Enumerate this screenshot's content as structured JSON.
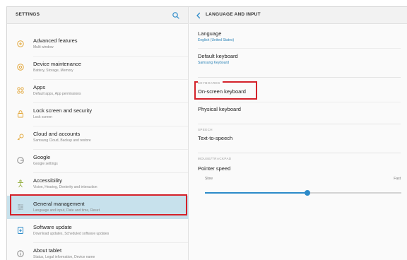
{
  "left_panel": {
    "title": "SETTINGS",
    "items": [
      {
        "title": "Advanced features",
        "subtitle": "Multi window",
        "icon": "puzzle-icon"
      },
      {
        "title": "Device maintenance",
        "subtitle": "Battery, Storage, Memory",
        "icon": "refresh-icon"
      },
      {
        "title": "Apps",
        "subtitle": "Default apps, App permissions",
        "icon": "apps-grid-icon"
      },
      {
        "title": "Lock screen and security",
        "subtitle": "Lock screen",
        "icon": "lock-icon"
      },
      {
        "title": "Cloud and accounts",
        "subtitle": "Samsung Cloud, Backup and restore",
        "icon": "key-icon"
      },
      {
        "title": "Google",
        "subtitle": "Google settings",
        "icon": "google-icon"
      },
      {
        "title": "Accessibility",
        "subtitle": "Vision, Hearing, Dexterity and interaction",
        "icon": "accessibility-icon"
      },
      {
        "title": "General management",
        "subtitle": "Language and input, Date and time, Reset",
        "icon": "sliders-icon"
      },
      {
        "title": "Software update",
        "subtitle": "Download updates, Scheduled software updates",
        "icon": "update-icon"
      },
      {
        "title": "About tablet",
        "subtitle": "Status, Legal information, Device name",
        "icon": "info-icon"
      }
    ],
    "selected_index": 7
  },
  "right_panel": {
    "title": "LANGUAGE AND INPUT",
    "language": {
      "title": "Language",
      "value": "English (United States)"
    },
    "default_keyboard": {
      "title": "Default keyboard",
      "value": "Samsung Keyboard"
    },
    "categories": {
      "keyboards": "KEYBOARDS",
      "speech": "SPEECH",
      "mouse": "MOUSE/TRACKPAD"
    },
    "on_screen_keyboard": "On-screen keyboard",
    "physical_keyboard": "Physical keyboard",
    "text_to_speech": "Text-to-speech",
    "pointer_speed": {
      "title": "Pointer speed",
      "min_label": "Slow",
      "max_label": "Fast",
      "value_fraction": 0.52
    }
  },
  "colors": {
    "accent": "#2d8bc9",
    "highlight_box": "#d4222a",
    "selected_bg": "#c7e1ec",
    "icon": "#e3a73a"
  }
}
